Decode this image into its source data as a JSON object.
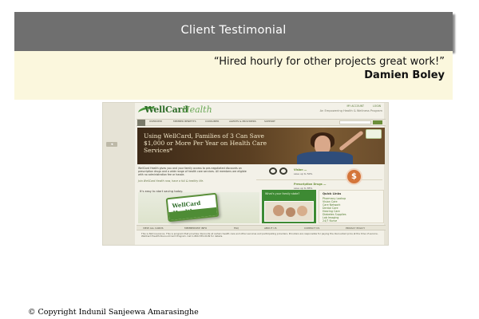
{
  "header": {
    "title": "Client Testimonial"
  },
  "testimonial": {
    "quote": "“Hired hourly for other projects great work!”",
    "author": "Damien Boley"
  },
  "site": {
    "logo_part1": "WellCard",
    "logo_part2": "Health",
    "tagline": "An Empowering Health & Wellness Program",
    "toplinks": [
      "MY ACCOUNT",
      "LOGIN"
    ],
    "arrow_tab": "◂",
    "nav": [
      "OVERVIEW",
      "MEMBER BENEFITS",
      "CONSUMER",
      "AGENTS & PROVIDERS",
      "SUPPORT"
    ],
    "hero_text": "Using WellCard, Families of 3 Can Save $1,000 or More Per Year on Health Care Services*",
    "intro_text": "WellCard Health gives you and your family access to pre-negotiated discounts on prescription drugs and a wide range of health care services. All members are eligible with no administration fee or hassle.",
    "intro_sig": "Join WellCard Health now, have a full & healthy life.",
    "vision_label": "Vision —",
    "vision_sub": "save up to 50%",
    "prescription_label": "Prescription Drugs —",
    "prescription_sub": "save up to 85%",
    "pill_icon_text": "$",
    "easy_label": "It's easy to start saving today.",
    "card_text": "WellCard Health",
    "green_panel_text": "What's your family state?",
    "quick_links_title": "Quick Links",
    "quick_links": [
      "Pharmacy Lookup",
      "Vision Care",
      "Care Network",
      "Dental Care",
      "Hearing Care",
      "Diabetes Supplies",
      "Lab Imaging",
      "24/7 Nurse"
    ],
    "footer_nav": [
      "VIEW ALL CARDS",
      "MEMBERSHIP INFO",
      "FAQ",
      "ABOUT US",
      "CONTACT US",
      "PRIVACY POLICY"
    ],
    "disclaimer": "This is Not Insurance. This is program that provides discounts at certain health care and other services and participating providers. Providers are responsible for paying the discounted price at the time of service. WellCard Health Discount Card Program. Call 1-800-555-0199 for details."
  },
  "copyright": "© Copyright Indunil Sanjeewa Amarasinghe",
  "colors": {
    "header_bg": "#6f6f6f",
    "quote_bg": "#fbf7dd",
    "brand_green": "#4e8c35"
  }
}
